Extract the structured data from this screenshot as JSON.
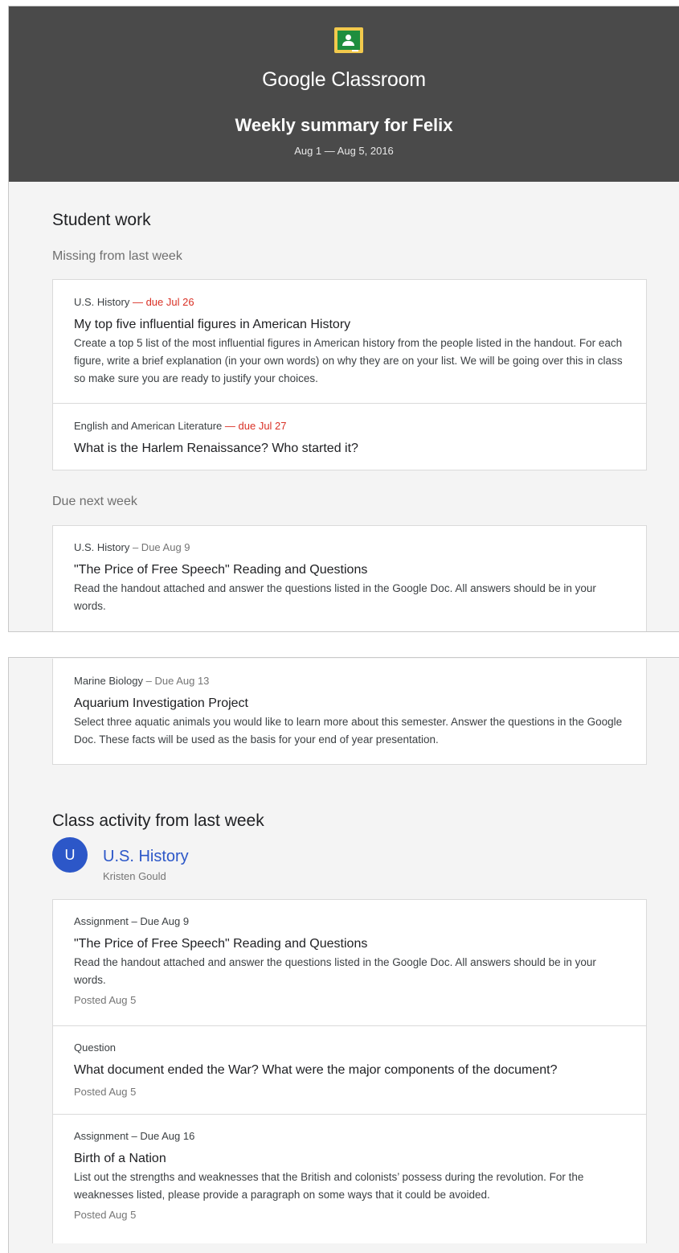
{
  "header": {
    "brand": "Google Classroom",
    "title": "Weekly summary for Felix",
    "date_range": "Aug 1 — Aug 5, 2016"
  },
  "student_work": {
    "title": "Student work",
    "missing": {
      "label": "Missing from last week",
      "items": [
        {
          "course": "U.S. History",
          "due": "— due Jul 26",
          "title": "My top five influential figures in American History",
          "description": "Create a top 5 list of the most influential figures in American history from the people listed in the handout. For each figure, write a brief explanation (in your own words) on why they are on your list. We will be going over this in class so make sure you are ready to justify your choices."
        },
        {
          "course": "English and American Literature",
          "due": "— due Jul 27",
          "title": "What is the Harlem Renaissance? Who started it?"
        }
      ]
    },
    "due_next": {
      "label": "Due next week",
      "items": [
        {
          "course": "U.S. History",
          "due": "– Due Aug 9",
          "title": "\"The Price of Free Speech\" Reading and Questions",
          "description": "Read the handout attached and answer the questions listed in the Google Doc. All answers should be in your words."
        },
        {
          "course": "Marine Biology",
          "due": "– Due Aug 13",
          "title": "Aquarium Investigation Project",
          "description": "Select three aquatic animals you would like to learn more about this semester. Answer the questions in the Google Doc. These facts will be used as the basis for your end of year presentation."
        }
      ]
    }
  },
  "class_activity": {
    "title": "Class activity from last week",
    "class": {
      "avatar_letter": "U",
      "name": "U.S. History",
      "teacher": "Kristen Gould",
      "color": "#2c57c8"
    },
    "items": [
      {
        "meta": "Assignment – Due Aug 9",
        "title": "\"The Price of Free Speech\" Reading and Questions",
        "description": "Read the handout attached and answer the questions listed in the Google Doc. All answers should be in your words.",
        "posted": "Posted Aug 5"
      },
      {
        "meta": "Question",
        "title": "What document ended the War? What were the major components of the document?",
        "posted": "Posted Aug 5"
      },
      {
        "meta": "Assignment – Due Aug 16",
        "title": "Birth of a Nation",
        "description": "List out the strengths and weaknesses that the British and colonists’ possess during the revolution. For the weaknesses listed, please provide a paragraph on some ways that it could be avoided.",
        "posted": "Posted Aug 5"
      }
    ]
  },
  "colors": {
    "header_bg": "#4a4a4a",
    "late": "#d93025",
    "accent": "#2c57c8",
    "page_bg": "#f4f4f4"
  }
}
